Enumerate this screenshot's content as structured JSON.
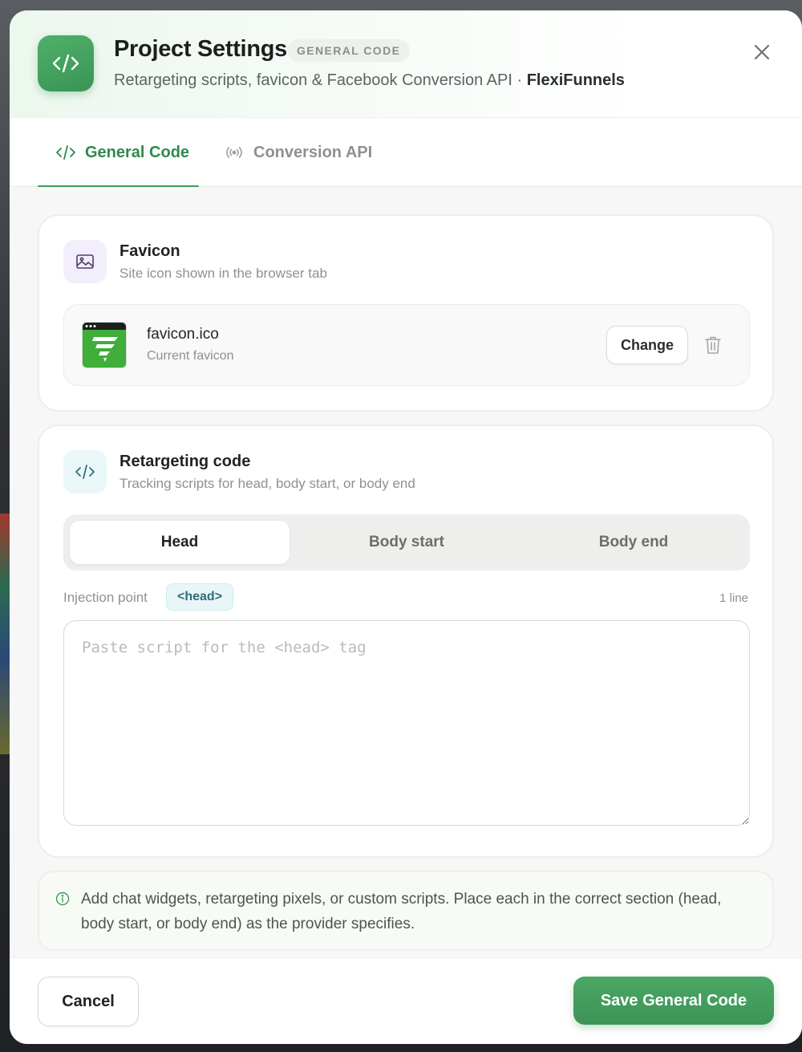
{
  "header": {
    "title": "Project Settings",
    "badge": "GENERAL CODE",
    "subtitle": "Retargeting scripts, favicon & Facebook Conversion API · ",
    "brand": "FlexiFunnels",
    "app_icon": "code-icon",
    "close_icon": "close-icon"
  },
  "tabs": [
    {
      "label": "General Code",
      "icon": "code-icon",
      "active": true
    },
    {
      "label": "Conversion API",
      "icon": "broadcast-icon",
      "active": false
    }
  ],
  "favicon_card": {
    "title": "Favicon",
    "subtitle": "Site icon shown in the browser tab",
    "icon": "image-icon",
    "file_name": "favicon.ico",
    "file_desc": "Current favicon",
    "change_label": "Change",
    "delete_icon": "trash-icon"
  },
  "retarget_card": {
    "title": "Retargeting code",
    "subtitle": "Tracking scripts for head, body start, or body end",
    "icon": "code-icon",
    "segments": [
      {
        "label": "Head",
        "active": true
      },
      {
        "label": "Body start",
        "active": false
      },
      {
        "label": "Body end",
        "active": false
      }
    ],
    "injection_label": "Injection point",
    "injection_tag": "<head>",
    "line_count": "1 line",
    "code_value": "",
    "code_placeholder": "Paste script for the <head> tag"
  },
  "info": {
    "icon": "info-icon",
    "text": "Add chat widgets, retargeting pixels, or custom scripts. Place each in the correct section (head, body start, or body end) as the provider specifies."
  },
  "footer": {
    "cancel_label": "Cancel",
    "save_label": "Save General Code"
  },
  "colors": {
    "accent": "#3e9a5a",
    "accent_text": "#2f8a4d",
    "chip_bg": "#e9f6f8",
    "chip_text": "#2f6c78"
  }
}
